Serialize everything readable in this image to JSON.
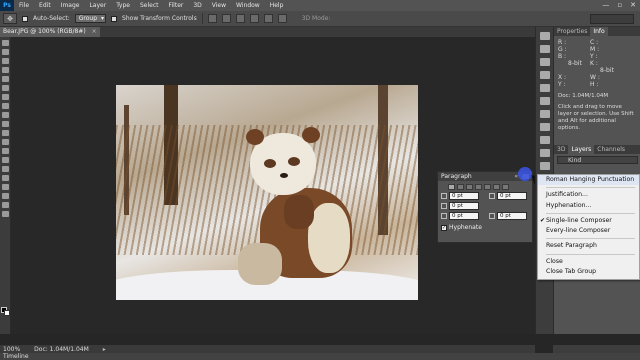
{
  "menubar": {
    "logo": "Ps",
    "items": [
      "File",
      "Edit",
      "Image",
      "Layer",
      "Type",
      "Select",
      "Filter",
      "3D",
      "View",
      "Window",
      "Help"
    ],
    "window_controls": [
      "—",
      "▫",
      "✕"
    ]
  },
  "options": {
    "auto_select_label": "Auto-Select:",
    "auto_select_value": "Group",
    "transform_label": "Show Transform Controls",
    "mode_3d_label": "3D Mode:",
    "workspace": ""
  },
  "document": {
    "tab_title": "Bear.JPG @ 100% (RGB/8#)",
    "close": "×"
  },
  "paragraph_panel": {
    "title": "Paragraph",
    "collapse": "«",
    "indent_left": "0 pt",
    "indent_right": "0 pt",
    "first_line": "0 pt",
    "space_before": "0 pt",
    "space_after": "0 pt",
    "hyphenate_label": "Hyphenate",
    "hyphenate_checked": "✓"
  },
  "flyout_menu": {
    "items": [
      {
        "label": "Roman Hanging Punctuation",
        "checked": ""
      },
      {
        "label": "Justification...",
        "checked": ""
      },
      {
        "label": "Hyphenation...",
        "checked": ""
      },
      {
        "label": "Single-line Composer",
        "checked": "✔"
      },
      {
        "label": "Every-line Composer",
        "checked": ""
      },
      {
        "label": "Reset Paragraph",
        "checked": ""
      },
      {
        "label": "Close",
        "checked": ""
      },
      {
        "label": "Close Tab Group",
        "checked": ""
      }
    ]
  },
  "right_panel": {
    "tabs": [
      "Properties",
      "Info"
    ],
    "info": {
      "r": "R :",
      "g": "G :",
      "b": "B :",
      "bit1": "8-bit",
      "c": "C :",
      "m": "M :",
      "y": "Y :",
      "k": "K :",
      "bit2": "8-bit",
      "x": "X :",
      "yy": "Y :",
      "w": "W :",
      "h": "H :",
      "doc": "Doc: 1.04M/1.04M",
      "hint": "Click and drag to move layer or selection. Use Shift and Alt for additional options."
    },
    "layer_tabs": [
      "3D",
      "Layers",
      "Channels"
    ],
    "kind": "Kind"
  },
  "status": {
    "zoom": "100%",
    "doc": "Doc: 1.04M/1.04M",
    "arrow": "▸"
  },
  "timeline_label": "Timeline"
}
